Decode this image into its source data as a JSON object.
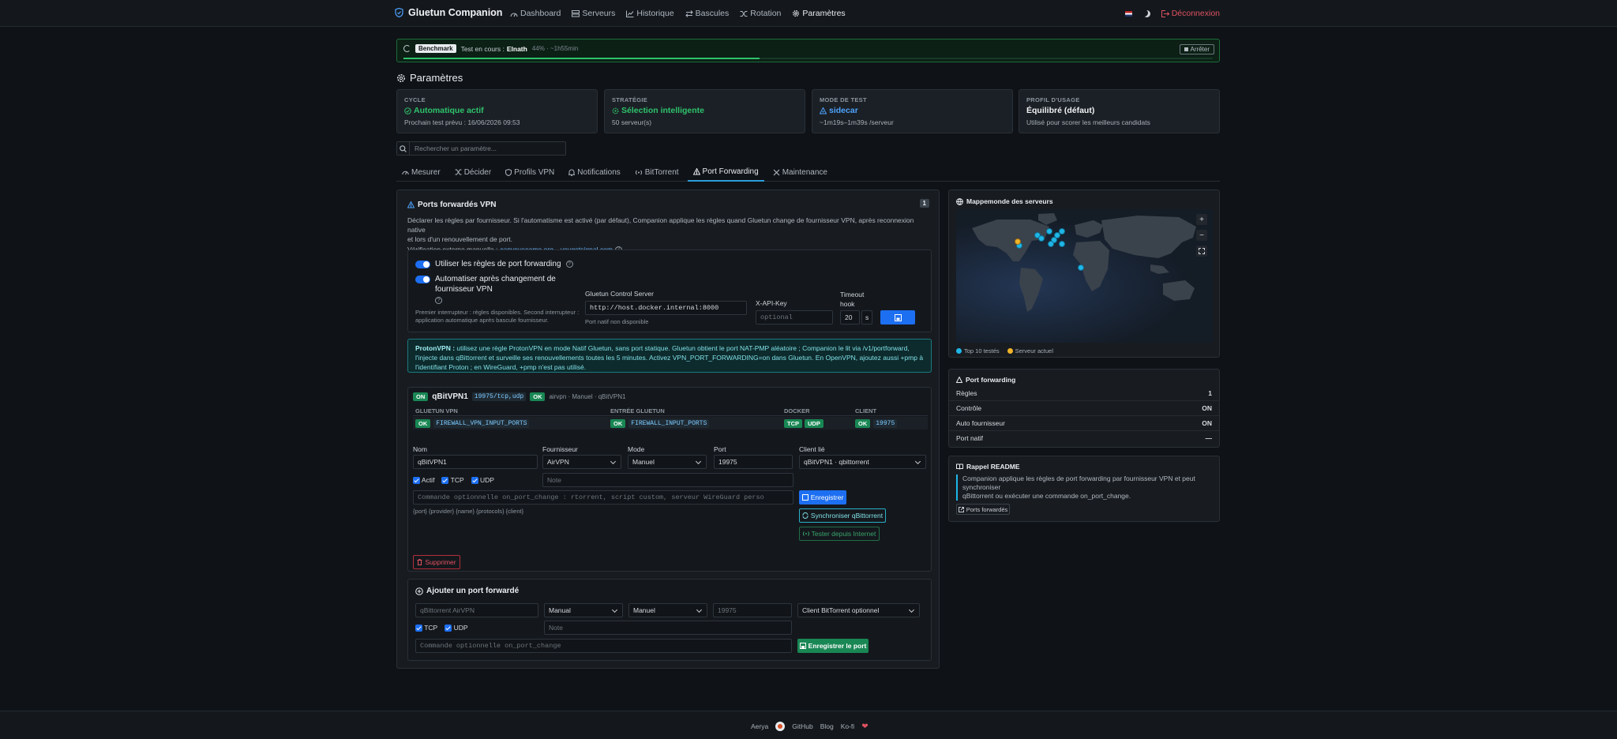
{
  "header": {
    "brand": "Gluetun Companion",
    "nav": [
      {
        "label": "Dashboard",
        "icon": "dashboard-icon"
      },
      {
        "label": "Serveurs",
        "icon": "servers-icon"
      },
      {
        "label": "Historique",
        "icon": "history-icon"
      },
      {
        "label": "Bascules",
        "icon": "switch-icon"
      },
      {
        "label": "Rotation",
        "icon": "shuffle-icon"
      },
      {
        "label": "Paramètres",
        "icon": "gear-icon"
      }
    ],
    "logout": "Déconnexion"
  },
  "benchmark": {
    "badge": "Benchmark",
    "text": "Test en cours :",
    "target": "Elnath",
    "progress_text": "44% · ~1h55min",
    "progress": 0.44,
    "stop": "Arrêter"
  },
  "page_title": "Paramètres",
  "cards": [
    {
      "label": "CYCLE",
      "value": "Automatique actif",
      "sub": "Prochain test prévu : 16/06/2026 09:53",
      "color": "#2ec36b",
      "icon": "check-circle-icon"
    },
    {
      "label": "STRATÉGIE",
      "value": "Sélection intelligente",
      "sub": "50 serveur(s)",
      "color": "#2ec36b",
      "icon": "gear-icon"
    },
    {
      "label": "MODE DE TEST",
      "value": "sidecar",
      "sub": "~1m19s–1m39s /serveur",
      "color": "#4da3ff",
      "icon": "sidecar-icon"
    },
    {
      "label": "PROFIL D'USAGE",
      "value": "Équilibré (défaut)",
      "sub": "Utilisé pour scorer les meilleurs candidats",
      "color": "#f1f3f5",
      "icon": ""
    }
  ],
  "search": {
    "placeholder": "Rechercher un paramètre..."
  },
  "tabs": [
    "Mesurer",
    "Décider",
    "Profils VPN",
    "Notifications",
    "BitTorrent",
    "Port Forwarding",
    "Maintenance"
  ],
  "pf": {
    "title": "Ports forwardés VPN",
    "count": "1",
    "desc1": "Déclarer les règles par fournisseur. Si l'automatisme est activé (par défaut), Companion applique les règles quand Gluetun change de fournisseur VPN, après reconnexion native",
    "desc2": "et lors d'un renouvellement de port.",
    "verify_label": "Vérification externe manuelle :",
    "link1": "canyouseeme.org",
    "sep": "·",
    "link2": "yougetsignal.com",
    "toggle1": "Utiliser les règles de port forwarding",
    "toggle2": "Automatiser après changement de fournisseur VPN",
    "toggle_note1": "Premier interrupteur : règles disponibles. Second interrupteur :",
    "toggle_note2": "application automatique après bascule fournisseur.",
    "gcs_label": "Gluetun Control Server",
    "gcs_value": "http://host.docker.internal:8000",
    "gcs_note": "Port natif non disponible",
    "api_label": "X-API-Key",
    "api_placeholder": "optional",
    "timeout_label1": "Timeout",
    "timeout_label2": "hook",
    "timeout_value": "20",
    "timeout_unit": "s",
    "proton_title": "ProtonVPN :",
    "proton_text1": " utilisez une règle ProtonVPN en mode Natif Gluetun, sans port statique. Gluetun obtient le port NAT-PMP aléatoire ; Companion le lit via /v1/portforward,",
    "proton_text2": "l'injecte dans qBittorrent et surveille ses renouvellements toutes les 5 minutes. Activez VPN_PORT_FORWARDING=on dans Gluetun. En OpenVPN, ajoutez aussi +pmp à",
    "proton_text3": "l'identifiant Proton ; en WireGuard, +pmp n'est pas utilisé."
  },
  "rule": {
    "on": "ON",
    "name": "qBitVPN1",
    "proto": "19975/tcp,udp",
    "ok": "OK",
    "meta": "airvpn · Manuel · qBitVPN1",
    "cols": [
      "GLUETUN VPN",
      "ENTRÉE GLUETUN",
      "DOCKER",
      "CLIENT"
    ],
    "env1": "FIREWALL_VPN_INPUT_PORTS",
    "env2": "FIREWALL_INPUT_PORTS",
    "tcp": "TCP",
    "udp": "UDP",
    "client_port": "19975",
    "f_name": "Nom",
    "f_provider": "Fournisseur",
    "f_mode": "Mode",
    "f_port": "Port",
    "f_client": "Client lié",
    "v_name": "qBitVPN1",
    "v_provider": "AirVPN",
    "v_mode": "Manuel",
    "v_port": "19975",
    "v_client": "qBitVPN1 · qbittorrent",
    "c_actif": "Actif",
    "c_tcp": "TCP",
    "c_udp": "UDP",
    "note_ph": "Note",
    "cmd_ph": "Commande optionnelle on_port_change : rtorrent, script custom, serveur WireGuard perso",
    "vars": "{port} {provider} {name} {protocols} {client}",
    "save": "Enregistrer",
    "sync": "Synchroniser qBittorrent",
    "test": "Tester depuis Internet",
    "delete": "Supprimer"
  },
  "add": {
    "title": "Ajouter un port forwardé",
    "name_ph": "qBittorrent AirVPN",
    "provider": "Manual",
    "mode": "Manuel",
    "port_ph": "19975",
    "client": "Client BitTorrent optionnel",
    "tcp": "TCP",
    "udp": "UDP",
    "note_ph": "Note",
    "cmd_ph": "Commande optionnelle on_port_change",
    "save": "Enregistrer le port"
  },
  "map": {
    "title": "Mappemonde des serveurs",
    "legend1": "Top 10 testés",
    "legend2": "Serveur actuel",
    "top_color": "#1fb6e8",
    "current_color": "#f0b429"
  },
  "pfsum": {
    "title": "Port forwarding",
    "rows": [
      {
        "k": "Règles",
        "v": "1"
      },
      {
        "k": "Contrôle",
        "v": "ON"
      },
      {
        "k": "Auto fournisseur",
        "v": "ON"
      },
      {
        "k": "Port natif",
        "v": "—"
      }
    ]
  },
  "readme": {
    "title": "Rappel README",
    "text1": "Companion applique les règles de port forwarding par fournisseur VPN et peut synchroniser",
    "text2": "qBittorrent ou exécuter une commande on_port_change.",
    "link": "Ports forwardés"
  },
  "footer": {
    "author": "Aerya",
    "links": [
      "GitHub",
      "Blog",
      "Ko-fi"
    ]
  }
}
